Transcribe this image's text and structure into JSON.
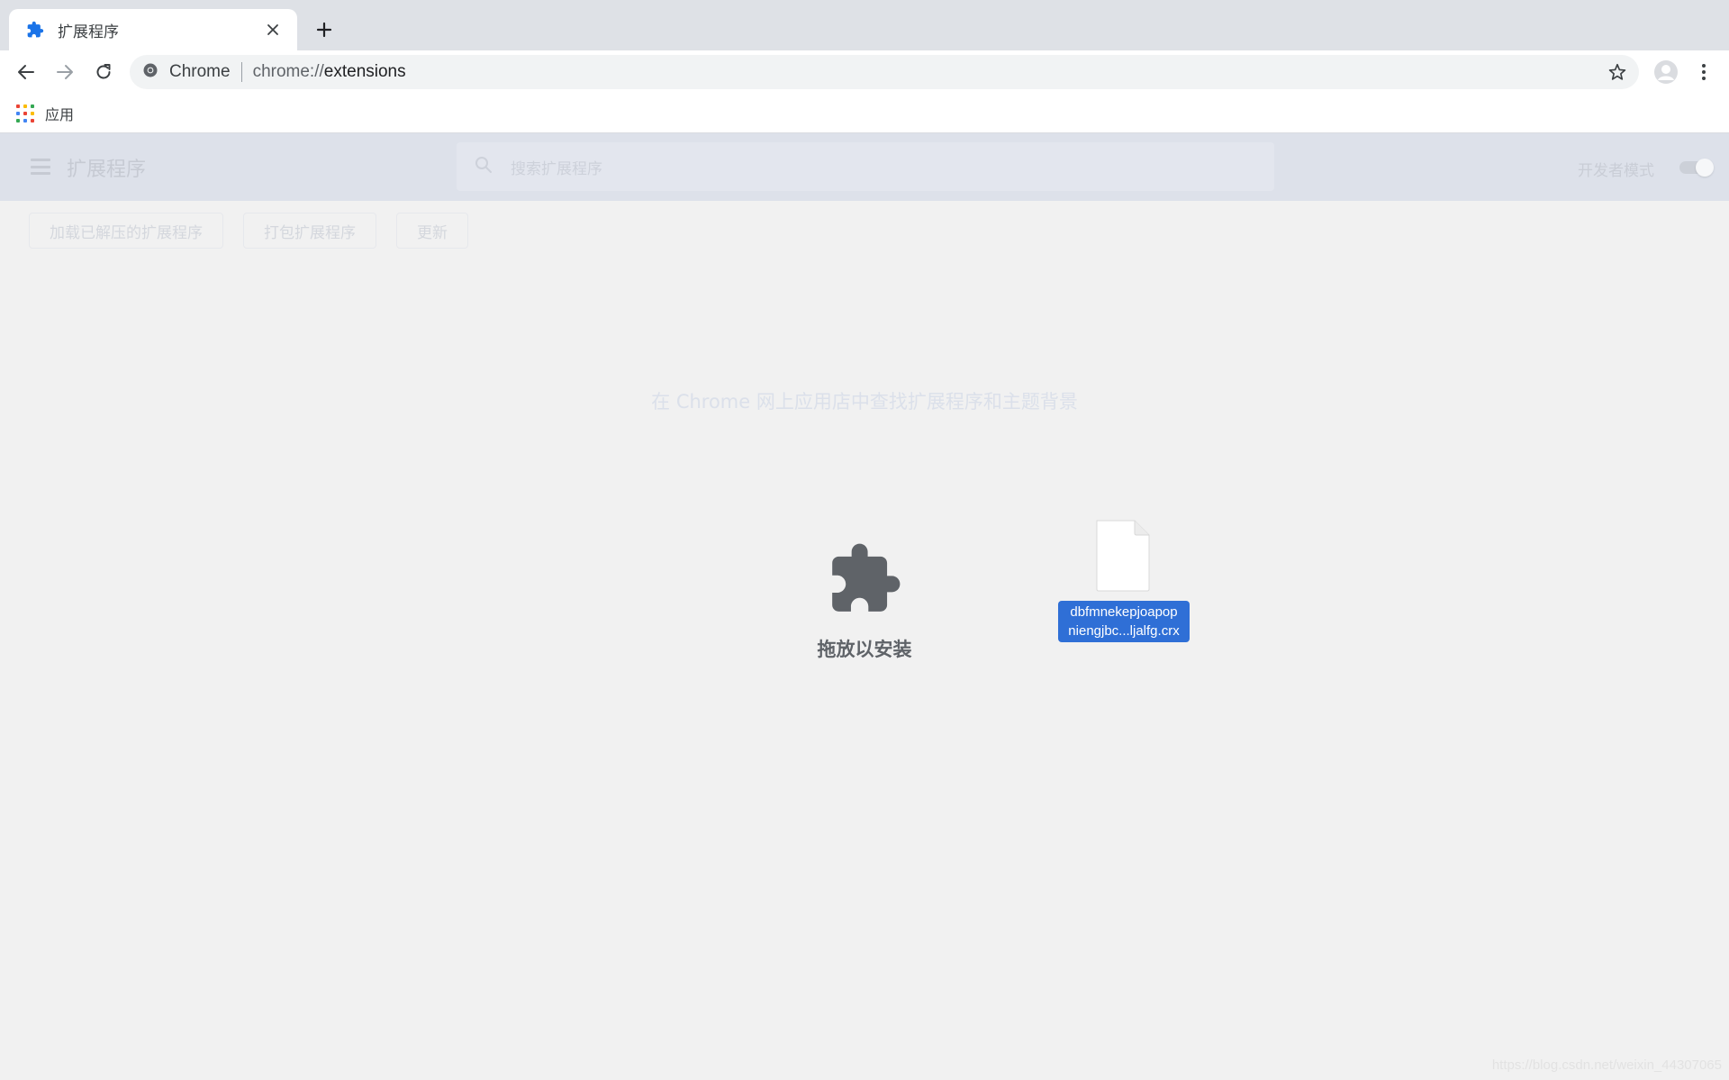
{
  "browser": {
    "tab": {
      "title": "扩展程序",
      "favicon": "puzzle-icon"
    },
    "new_tab_icon": "plus-icon",
    "omnibox": {
      "site_label": "Chrome",
      "url_scheme": "chrome://",
      "url_path": "extensions"
    },
    "bookmarks": {
      "apps_label": "应用"
    }
  },
  "extensions_page": {
    "title": "扩展程序",
    "search_placeholder": "搜索扩展程序",
    "developer_mode_label": "开发者模式",
    "developer_mode_on": true,
    "actions": [
      "加载已解压的扩展程序",
      "打包扩展程序",
      "更新"
    ],
    "webstore_link": "在 Chrome 网上应用店中查找扩展程序和主题背景",
    "drop_zone_label": "拖放以安装"
  },
  "dragged_file": {
    "name_line1": "dbfmnekepjoapop",
    "name_line2": "niengjbc...ljalfg.crx"
  },
  "watermark": "https://blog.csdn.net/weixin_44307065",
  "colors": {
    "accent": "#2f6fd6",
    "header_overlay": "#dde1ea",
    "page_bg": "#f1f1f1"
  }
}
